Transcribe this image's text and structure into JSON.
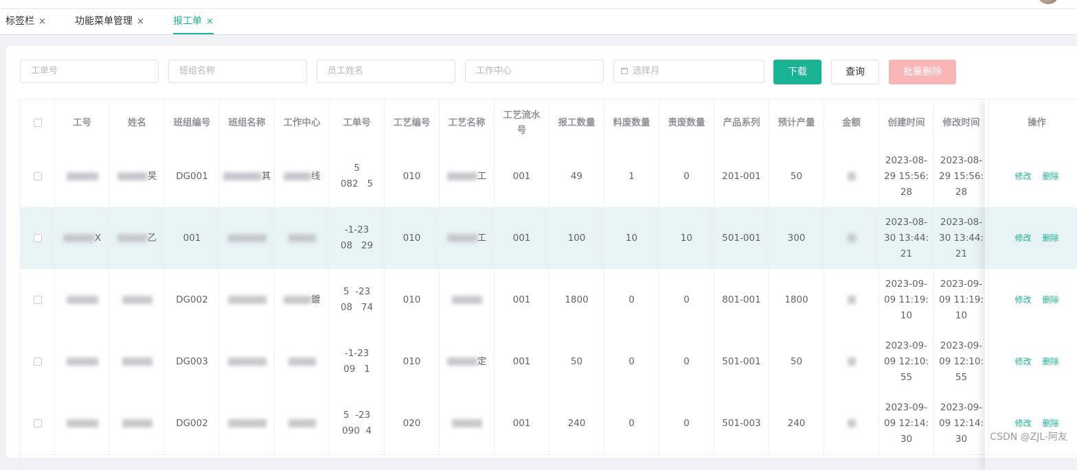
{
  "tabs": [
    {
      "label": "标签栏",
      "close": "×"
    },
    {
      "label": "功能菜单管理",
      "close": "×"
    },
    {
      "label": "报工单",
      "close": "×"
    }
  ],
  "filters": {
    "work_order_placeholder": "工单号",
    "team_name_placeholder": "班组名称",
    "employee_name_placeholder": "员工姓名",
    "work_center_placeholder": "工作中心",
    "month_placeholder": "选择月"
  },
  "buttons": {
    "download": "下载",
    "query": "查询",
    "batch_delete": "批量删除"
  },
  "columns": [
    "工号",
    "姓名",
    "班组编号",
    "班组名称",
    "工作中心",
    "工单号",
    "工艺编号",
    "工艺名称",
    "工艺流水号",
    "报工数量",
    "料废数量",
    "责废数量",
    "产品系列",
    "预计产量",
    "金额",
    "创建时间",
    "修改时间",
    "操作"
  ],
  "rows": [
    {
      "emp_no": "",
      "name": "旲",
      "team_no": "DG001",
      "team_name": "其",
      "work_center": "线",
      "order_line1": "5",
      "order_line2": "082   5",
      "proc_no": "010",
      "proc_name": "工",
      "serial": "001",
      "qty": "49",
      "mat_scrap": "1",
      "resp_scrap": "0",
      "series": "201-001",
      "expected": "50",
      "amount": "",
      "created": [
        "2023-08-",
        "29 15:56:",
        "28"
      ],
      "modified": [
        "2023-08-",
        "29 15:56:",
        "28"
      ]
    },
    {
      "emp_no": "X",
      "name": "乙",
      "team_no": "001",
      "team_name": "",
      "work_center": "",
      "order_line1": "-1-23",
      "order_line2": "08   29",
      "proc_no": "010",
      "proc_name": "工",
      "serial": "001",
      "qty": "100",
      "mat_scrap": "10",
      "resp_scrap": "10",
      "series": "501-001",
      "expected": "300",
      "amount": "",
      "created": [
        "2023-08-",
        "30 13:44:",
        "21"
      ],
      "modified": [
        "2023-08-",
        "30 13:44:",
        "21"
      ]
    },
    {
      "emp_no": "",
      "name": "",
      "team_no": "DG002",
      "team_name": "",
      "work_center": "鍍",
      "order_line1": "5  -23",
      "order_line2": "08   74",
      "proc_no": "010",
      "proc_name": "",
      "serial": "001",
      "qty": "1800",
      "mat_scrap": "0",
      "resp_scrap": "0",
      "series": "801-001",
      "expected": "1800",
      "amount": "",
      "created": [
        "2023-09-",
        "09 11:19:",
        "10"
      ],
      "modified": [
        "2023-09-",
        "09 11:19:",
        "10"
      ]
    },
    {
      "emp_no": "",
      "name": "",
      "team_no": "DG003",
      "team_name": "",
      "work_center": "",
      "order_line1": "-1-23",
      "order_line2": "09   1",
      "proc_no": "010",
      "proc_name": "定",
      "serial": "001",
      "qty": "50",
      "mat_scrap": "0",
      "resp_scrap": "0",
      "series": "501-001",
      "expected": "50",
      "amount": "",
      "created": [
        "2023-09-",
        "09 12:10:",
        "55"
      ],
      "modified": [
        "2023-09-",
        "09 12:10:",
        "55"
      ]
    },
    {
      "emp_no": "",
      "name": "",
      "team_no": "DG002",
      "team_name": "",
      "work_center": "",
      "order_line1": "5  -23",
      "order_line2": "090  4",
      "proc_no": "020",
      "proc_name": "",
      "serial": "001",
      "qty": "240",
      "mat_scrap": "0",
      "resp_scrap": "0",
      "series": "501-003",
      "expected": "240",
      "amount": "",
      "created": [
        "2023-09-",
        "09 12:14:",
        "30"
      ],
      "modified": [
        "2023-09-",
        "09 12:14:",
        "30"
      ]
    }
  ],
  "row_actions": {
    "edit": "修改",
    "delete": "删除"
  },
  "watermark": "CSDN @ZJL-阿友",
  "colors": {
    "accent": "#1ab394",
    "danger_disabled": "#fab6b6",
    "highlight_row": "#e8f4f3"
  }
}
